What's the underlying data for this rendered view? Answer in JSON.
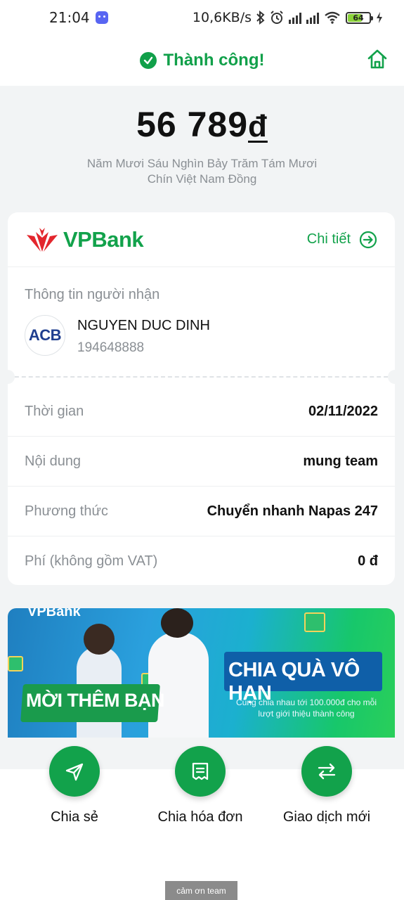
{
  "status_bar": {
    "time": "21:04",
    "network_speed": "10,6KB/s",
    "battery": "64",
    "icons": [
      "discord-icon",
      "bluetooth-icon",
      "alarm-icon",
      "signal-icon",
      "signal-icon",
      "wifi-icon",
      "battery-icon",
      "charging-icon"
    ]
  },
  "header": {
    "title": "Thành công!",
    "icons": [
      "check-circle-icon",
      "home-icon"
    ]
  },
  "amount": {
    "value": "56 789",
    "currency": "đ",
    "in_words": "Năm Mươi Sáu Nghìn Bảy Trăm Tám Mươi Chín Việt Nam Đồng"
  },
  "card": {
    "bank_name": "VPBank",
    "detail_label": "Chi tiết",
    "recipient_label": "Thông tin người nhận",
    "recipient_bank_logo": "ACB",
    "recipient_name": "NGUYEN DUC DINH",
    "recipient_account": "194648888",
    "rows": [
      {
        "label": "Thời gian",
        "value": "02/11/2022"
      },
      {
        "label": "Nội dung",
        "value": "mung team"
      },
      {
        "label": "Phương thức",
        "value": "Chuyển nhanh Napas 247"
      },
      {
        "label": "Phí (không gồm VAT)",
        "value": "0 đ"
      }
    ]
  },
  "banner": {
    "brand": "VPBank",
    "invite": "MỜI THÊM BẠN",
    "gift": "CHIA QUÀ VÔ HẠN",
    "subtitle": "Cùng chia nhau tới 100.000đ cho mỗi lượt giới thiệu thành công"
  },
  "actions": [
    {
      "label": "Chia sẻ",
      "icon": "send-icon"
    },
    {
      "label": "Chia hóa đơn",
      "icon": "receipt-icon"
    },
    {
      "label": "Giao dịch mới",
      "icon": "swap-icon"
    }
  ],
  "toast": "cảm ơn team",
  "colors": {
    "primary": "#12a24b",
    "background": "#f2f4f5",
    "muted_text": "#8a8f94"
  }
}
